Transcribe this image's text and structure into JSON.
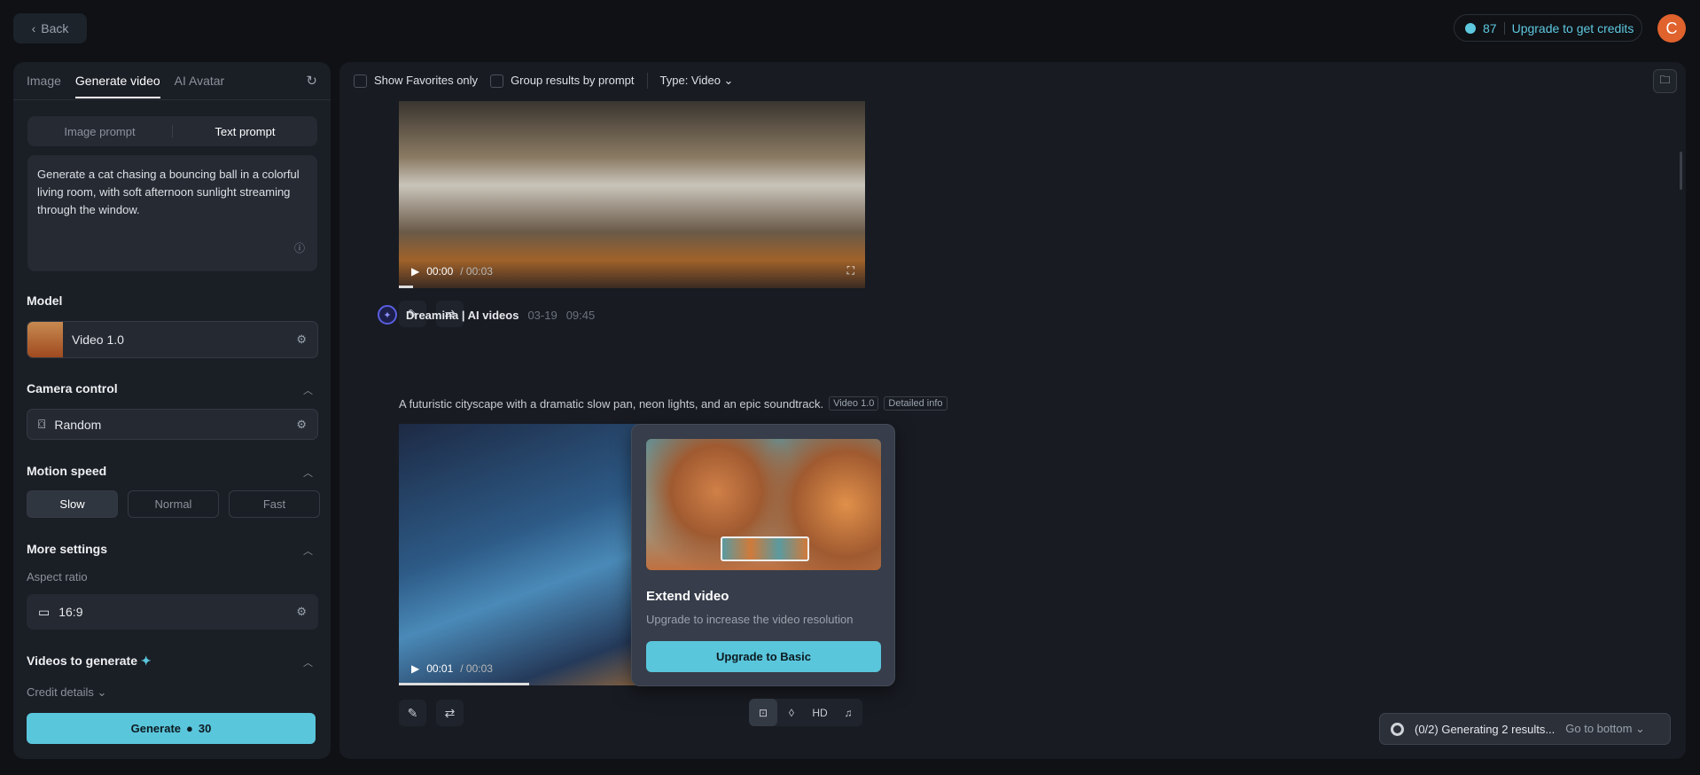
{
  "header": {
    "back": "Back",
    "credits": "87",
    "upgrade": "Upgrade to get credits",
    "avatar": "C"
  },
  "left": {
    "tabs": [
      "Image",
      "Generate video",
      "AI Avatar"
    ],
    "prompt_modes": [
      "Image prompt",
      "Text prompt"
    ],
    "prompt": "Generate a cat chasing a bouncing ball in a colorful living room, with soft afternoon sunlight streaming through the window.",
    "model_label": "Model",
    "model": "Video 1.0",
    "camera_label": "Camera control",
    "camera": "Random",
    "motion_label": "Motion speed",
    "speeds": [
      "Slow",
      "Normal",
      "Fast"
    ],
    "more_label": "More settings",
    "aspect_label": "Aspect ratio",
    "aspect": "16:9",
    "videos_label": "Videos to generate",
    "credit_details": "Credit details",
    "generate": "Generate",
    "generate_cost": "30"
  },
  "main": {
    "show_favorites": "Show Favorites only",
    "group_results": "Group results by prompt",
    "type": "Type: Video",
    "video1": {
      "time": "00:00",
      "duration": "/ 00:03",
      "progress": 0.03
    },
    "message": {
      "author": "Dreamina | AI videos",
      "date": "03-19",
      "time": "09:45",
      "prompt": "A futuristic cityscape with a dramatic slow pan, neon lights, and an epic soundtrack.",
      "model_tag": "Video 1.0",
      "info_tag": "Detailed info"
    },
    "video2": {
      "time": "00:01",
      "duration": "/ 00:03",
      "progress": 0.28
    },
    "popover": {
      "title": "Extend video",
      "desc": "Upgrade to increase the video resolution",
      "button": "Upgrade to Basic"
    },
    "hd": "HD",
    "generating": "(0/2) Generating 2 results...",
    "go_bottom": "Go to bottom"
  }
}
